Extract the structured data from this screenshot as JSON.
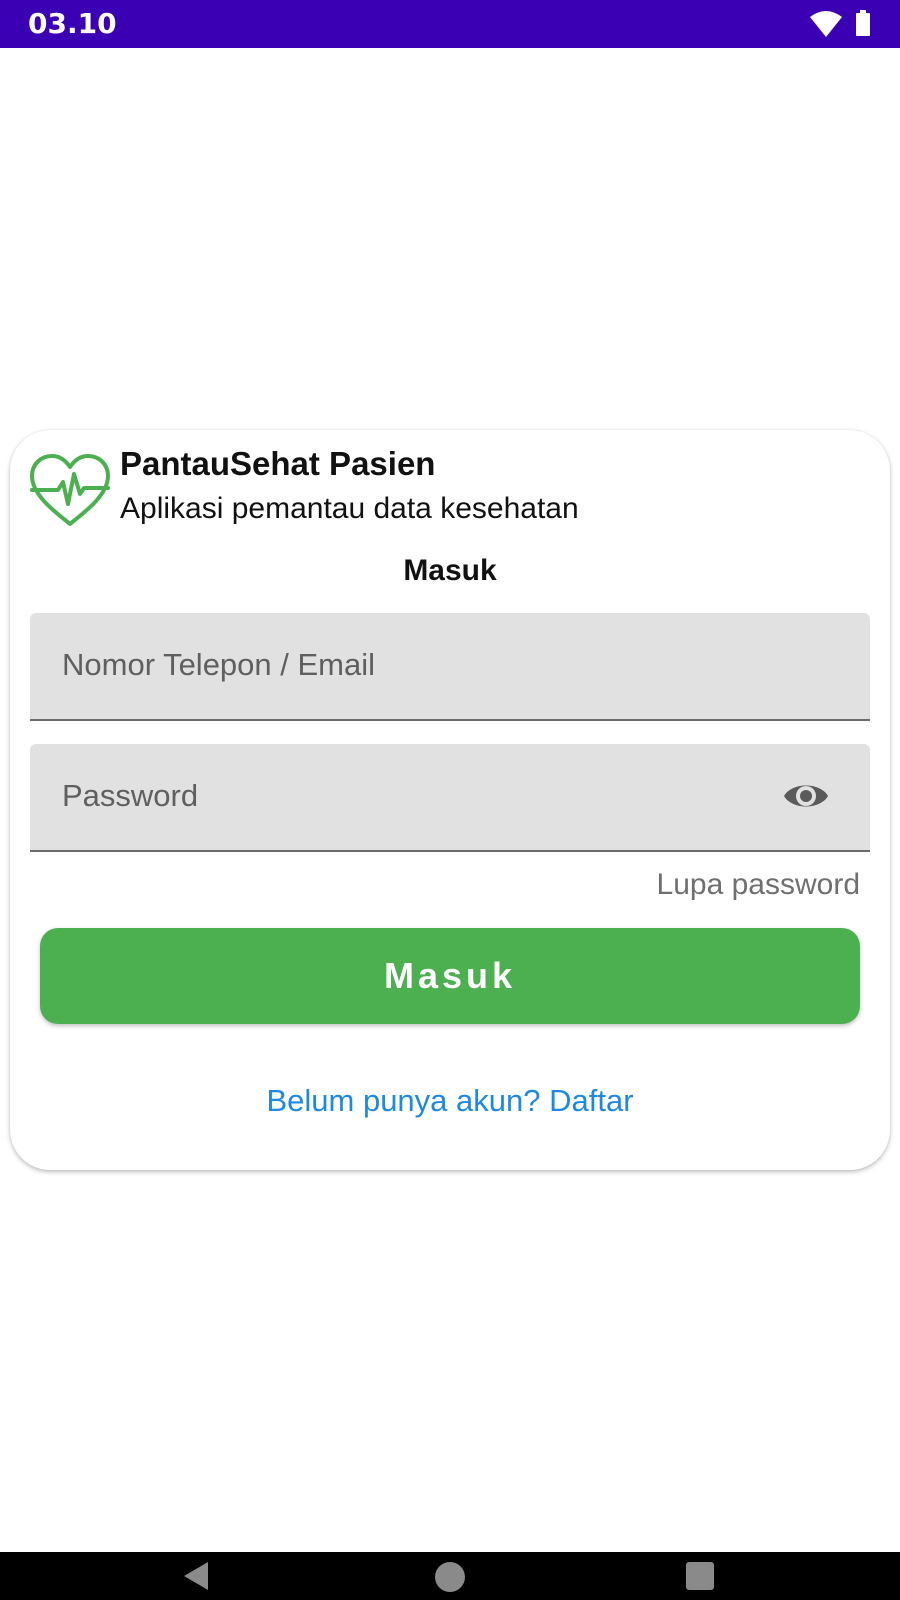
{
  "status_bar": {
    "time": "03.10",
    "background_color": "#3c00b4",
    "icons": [
      "wifi-icon",
      "battery-icon"
    ]
  },
  "header": {
    "logo_icon": "heart-pulse-icon",
    "app_title": "PantauSehat Pasien",
    "app_subtitle": "Aplikasi pemantau data kesehatan"
  },
  "form": {
    "heading": "Masuk",
    "email_field": {
      "placeholder": "Nomor Telepon / Email",
      "value": ""
    },
    "password_field": {
      "placeholder": "Password",
      "value": "",
      "toggle_icon": "eye-icon"
    },
    "forgot_password_label": "Lupa password",
    "submit_label": "Masuk",
    "register_label": "Belum punya akun? Daftar"
  },
  "nav_bar": {
    "icons": [
      "back-icon",
      "home-icon",
      "recents-icon"
    ]
  },
  "colors": {
    "primary": "#4caf50",
    "link": "#1e88e5",
    "status_bar": "#3c00b4",
    "field_background": "#e1e1e1"
  }
}
